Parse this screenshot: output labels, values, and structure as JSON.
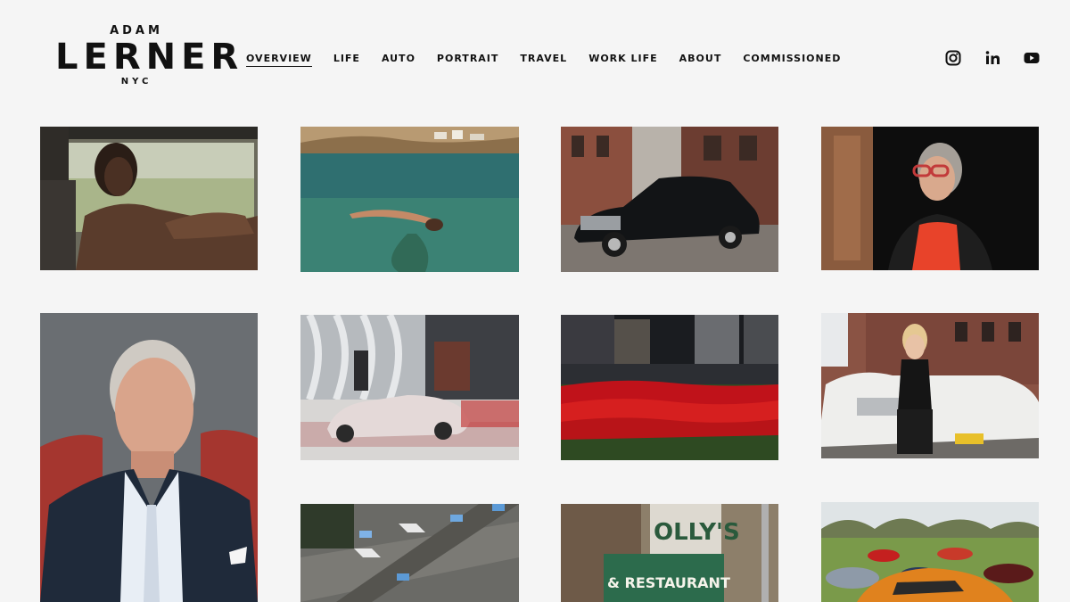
{
  "logo": {
    "top": "ADAM",
    "main": "LERNER",
    "sub": "NYC"
  },
  "nav": [
    {
      "label": "OVERVIEW",
      "active": true
    },
    {
      "label": "LIFE"
    },
    {
      "label": "AUTO"
    },
    {
      "label": "PORTRAIT"
    },
    {
      "label": "TRAVEL"
    },
    {
      "label": "WORK LIFE"
    },
    {
      "label": "ABOUT"
    },
    {
      "label": "COMMISSIONED"
    }
  ],
  "social": [
    "instagram-icon",
    "linkedin-icon",
    "youtube-icon"
  ],
  "gallery": [
    {
      "name": "man-in-car-photo"
    },
    {
      "name": "diver-in-lake-photo"
    },
    {
      "name": "classic-car-street-photo"
    },
    {
      "name": "woman-red-glasses-portrait"
    },
    {
      "name": "silver-haired-man-portrait"
    },
    {
      "name": "motion-car-storefront-photo"
    },
    {
      "name": "red-tulips-city-photo"
    },
    {
      "name": "woman-on-white-car-photo"
    },
    {
      "name": "aerial-street-photo"
    },
    {
      "name": "restaurant-sign-photo"
    },
    {
      "name": "classic-cars-field-photo"
    }
  ]
}
